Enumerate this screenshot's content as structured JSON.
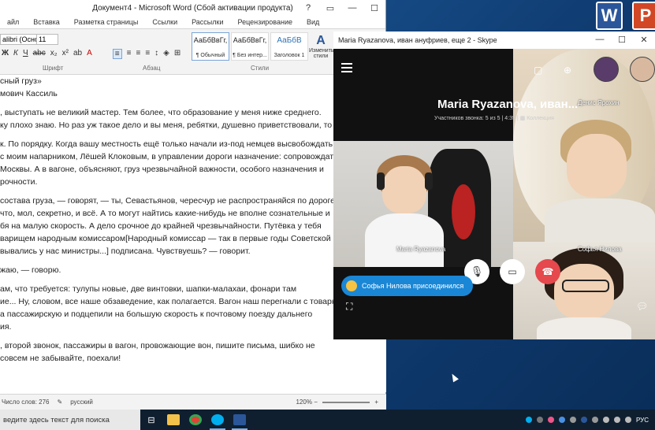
{
  "word": {
    "title": "Документ4 - Microsoft Word (Сбой активации продукта)",
    "tabs": [
      "айл",
      "Вставка",
      "Разметка страницы",
      "Ссылки",
      "Рассылки",
      "Рецензирование",
      "Вид"
    ],
    "font_name": "alibri (Основ",
    "font_size": "11",
    "group_labels": {
      "font": "Шрифт",
      "paragraph": "Абзац",
      "styles": "Стили"
    },
    "styles": [
      {
        "preview": "АаБбВвГг,",
        "name": "¶ Обычный"
      },
      {
        "preview": "АаБбВвГг,",
        "name": "¶ Без интер..."
      },
      {
        "preview": "АаБбВ",
        "name": "Заголовок 1"
      }
    ],
    "change_styles_label": "Изменить стили",
    "doc_lines": [
      "сный груз»",
      "мович Кассиль",
      "",
      ", выступать не великий мастер. Тем более, что образование у меня ниже среднего.",
      "ку плохо знаю. Но раз уж такое дело и вы меня, ребятки, душевно приветствовали, то",
      "",
      "к. По порядку. Когда вашу местность ещё только начали из-под немцев высвобождать,",
      "с моим напарником, Лёшей Клоковым, в управлении дороги назначение: сопровождат",
      "Москвы. А в вагоне, объясняют, груз чрезвычайной важности, особого назначения и",
      "рочности.",
      "",
      "состава груза, — говорят, — ты, Севастьянов, чересчур не распространяйся по дороге.",
      "что, мол, секретно, и всё. А то могут найтись какие-нибудь не вполне сознательные и",
      "бя на малую скорость. А дело срочное до крайней чрезвычайности. Путёвка у тебя",
      "варищем народным комиссаром[Народный комиссар — так в первые годы Советской",
      "вывались у нас министры...] подписана. Чувствуешь? — говорит.",
      "",
      "жаю, — говорю.",
      "",
      "ам, что требуется: тулупы новые, две винтовки, шапки-малахаи, фонари там",
      "ие... Ну, словом, все наше обзаведение, как полагается. Вагон наш перегнали с товарной",
      "а пассажирскую и подцепили на большую скорость к почтовому поезду дальнего",
      "ия.",
      "",
      ", второй звонок, пассажиры в вагон, провожающие вон, пишите письма, шибко не",
      "совсем не забывайте, поехали!"
    ],
    "status_words": "Число слов: 276",
    "status_lang": "русский",
    "zoom_level": "120%"
  },
  "skype": {
    "title": "Maria Ryazanova, иван ануфриев, еще 2 - Skype",
    "call_name": "Maria Ryazanova, иван...",
    "participants": "Участников звонка: 5 из 5",
    "duration": "4:35",
    "collection": "Коллекция",
    "tile_main_name": "Maria Ryazanova",
    "tile_right_top_name": "Денис Ярохин",
    "tile_right_bot_name": "Софья Нилова",
    "toast": "Софья Нилова присоединился"
  },
  "taskbar": {
    "search_placeholder": "ведите здесь текст для поиска",
    "lang": "РУС"
  },
  "colors": {
    "word_blue": "#2b579a",
    "skype_blue": "#1a87d6",
    "hangup_red": "#e5484d"
  }
}
